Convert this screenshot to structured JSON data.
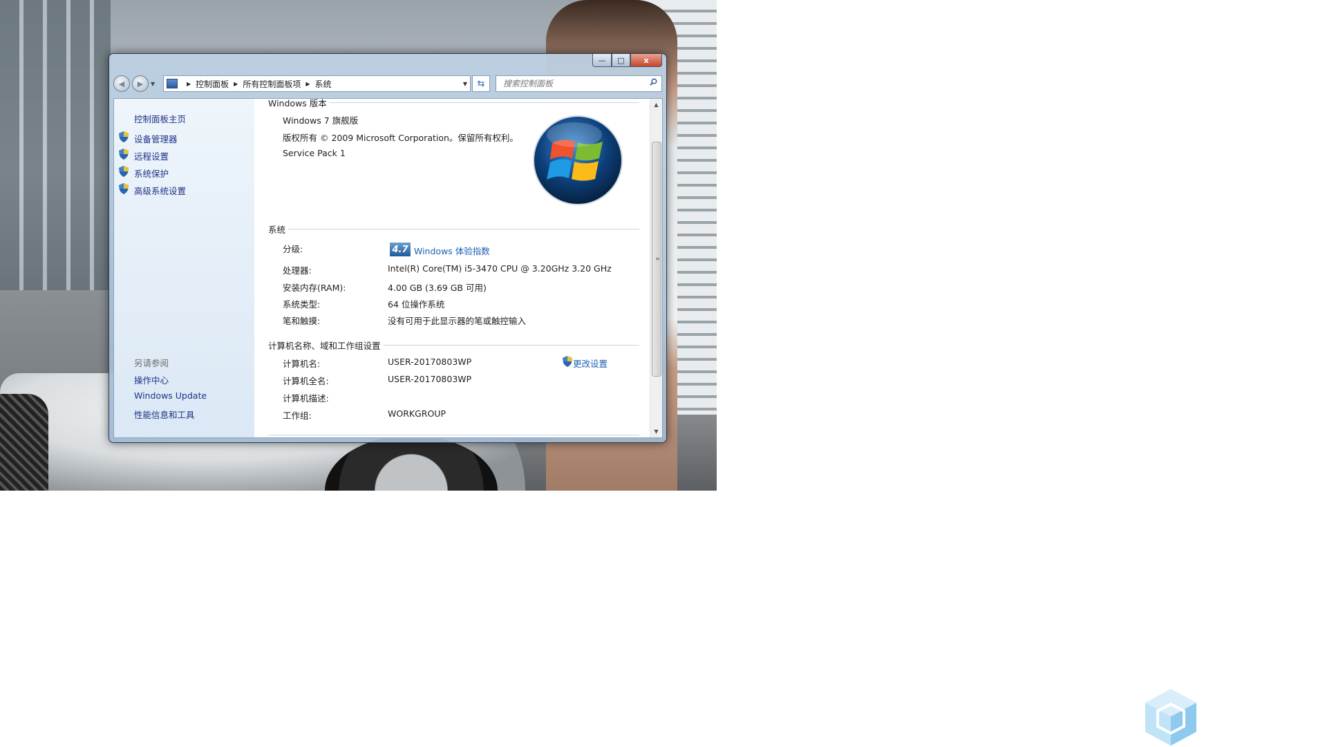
{
  "window": {
    "caption_buttons": {
      "minimize": "—",
      "maximize": "□",
      "close": "x"
    },
    "address_crumbs": [
      "控制面板",
      "所有控制面板项",
      "系统"
    ],
    "search_placeholder": "搜索控制面板"
  },
  "sidebar": {
    "home": "控制面板主页",
    "tasks": [
      "设备管理器",
      "远程设置",
      "系统保护",
      "高级系统设置"
    ],
    "see_also_title": "另请参阅",
    "see_also": [
      "操作中心",
      "Windows Update",
      "性能信息和工具"
    ]
  },
  "windows_edition": {
    "title": "Windows 版本",
    "edition": "Windows 7 旗舰版",
    "copyright": "版权所有 © 2009 Microsoft Corporation。保留所有权利。",
    "service_pack": "Service Pack 1"
  },
  "system": {
    "title": "系统",
    "rating_label": "分级:",
    "rating_score": "4.7",
    "rating_link": "Windows 体验指数",
    "processor_label": "处理器:",
    "processor_value": "Intel(R) Core(TM) i5-3470 CPU @ 3.20GHz   3.20 GHz",
    "ram_label": "安装内存(RAM):",
    "ram_value": "4.00 GB (3.69 GB 可用)",
    "type_label": "系统类型:",
    "type_value": "64 位操作系统",
    "pen_label": "笔和触摸:",
    "pen_value": "没有可用于此显示器的笔或触控输入"
  },
  "computer": {
    "title": "计算机名称、域和工作组设置",
    "name_label": "计算机名:",
    "name_value": "USER-20170803WP",
    "fullname_label": "计算机全名:",
    "fullname_value": "USER-20170803WP",
    "desc_label": "计算机描述:",
    "desc_value": "",
    "workgroup_label": "工作组:",
    "workgroup_value": "WORKGROUP",
    "change_settings": "更改设置"
  }
}
